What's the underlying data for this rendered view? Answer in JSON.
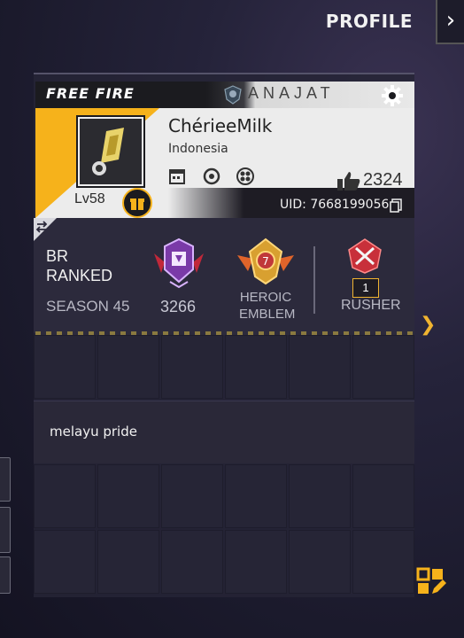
{
  "header": {
    "title": "PROFILE",
    "close_icon": "chevron-right-icon"
  },
  "banner": {
    "brand": "FREE FIRE",
    "guild_name": "ANAJAT",
    "player_name": "ChérieeMilk",
    "country": "Indonesia",
    "level": "Lv58",
    "likes": "2324",
    "uid": "UID: 7668199056",
    "colors": {
      "accent": "#f6b21b",
      "banner_bg": "#ececec",
      "header_dark": "#1b1b1f"
    }
  },
  "ranked": {
    "mode": "BR\nRANKED",
    "season": "SEASON 45",
    "points": "3266",
    "emblem_label": "HEROIC\nEMBLEM",
    "rusher_level": "1",
    "rusher_label": "RUSHER"
  },
  "bio": {
    "text": "melayu pride"
  }
}
